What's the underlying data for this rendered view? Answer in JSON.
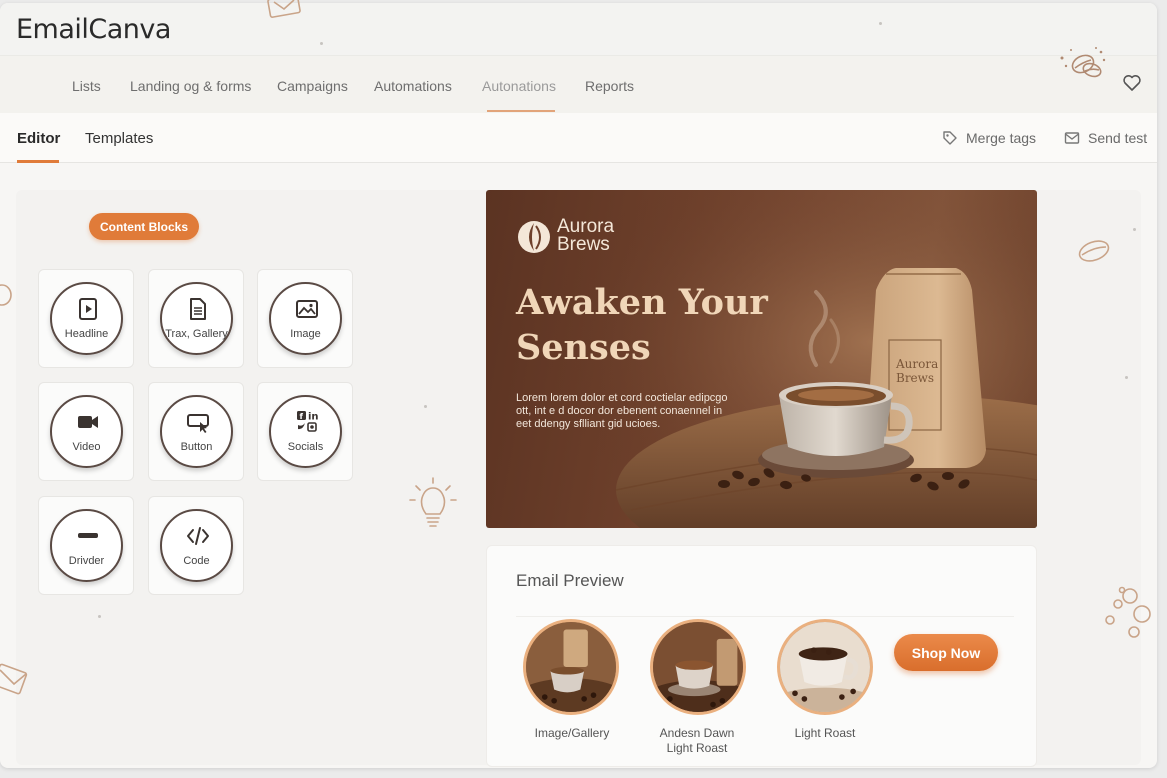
{
  "app": {
    "title": "EmailCanva"
  },
  "nav": {
    "items": [
      {
        "label": "Lists"
      },
      {
        "label": "Landing og & forms"
      },
      {
        "label": "Campaigns"
      },
      {
        "label": "Automations"
      },
      {
        "label": "Autonations"
      },
      {
        "label": "Reports"
      }
    ],
    "active_index": 4,
    "favorite_icon": "heart-icon"
  },
  "tabs": {
    "items": [
      {
        "label": "Editor"
      },
      {
        "label": "Templates"
      }
    ],
    "active_index": 0,
    "merge_tags_label": "Merge tags",
    "send_test_label": "Send test"
  },
  "content_blocks": {
    "badge": "Content Blocks",
    "blocks": [
      {
        "label": "Headline",
        "icon": "play-doc-icon"
      },
      {
        "label": "Trax, Gallery",
        "icon": "document-icon"
      },
      {
        "label": "Image",
        "icon": "image-icon"
      },
      {
        "label": "Video",
        "icon": "video-camera-icon"
      },
      {
        "label": "Button",
        "icon": "cursor-button-icon"
      },
      {
        "label": "Socials",
        "icon": "social-icons-icon"
      },
      {
        "label": "Drivder",
        "icon": "divider-icon"
      },
      {
        "label": "Code",
        "icon": "code-icon"
      }
    ]
  },
  "hero": {
    "brand": "Aurora\nBrews",
    "headline": "Awaken Your Senses",
    "body": "Lorem lorem dolor et cord coctielar edipcgo ott, int e d docor dor ebenent conaennel in eet ddengy sflliant gid ucioes.",
    "bag_label": "Aurora\nBrews",
    "colors": {
      "accent": "#e07b39",
      "headline": "#f0d6b8"
    }
  },
  "preview": {
    "title": "Email Preview",
    "items": [
      {
        "label": "Image/Gallery"
      },
      {
        "label": "Andesn Dawn\nLight Roast"
      },
      {
        "label": "Light Roast"
      }
    ],
    "cta": "Shop Now"
  }
}
